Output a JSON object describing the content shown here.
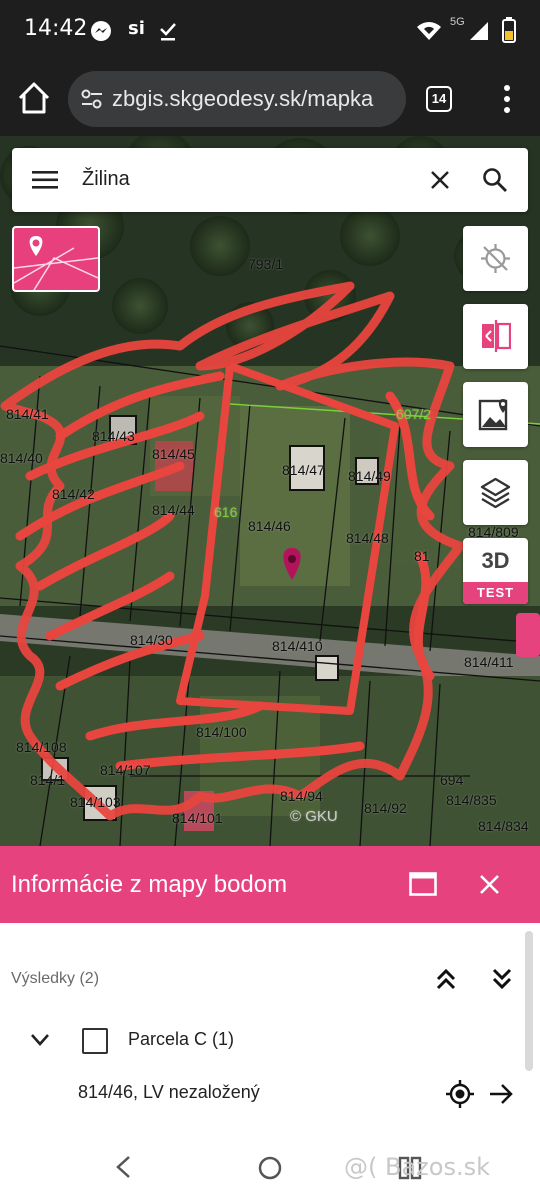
{
  "status_bar": {
    "time": "14:42",
    "icons": [
      "messenger-icon",
      "si-icon",
      "check-icon",
      "wifi-icon",
      "signal-icon",
      "battery-icon"
    ],
    "network": "5G",
    "si": "si"
  },
  "browser": {
    "url": "zbgis.skgeodesy.sk/mapka",
    "tab_count": "14"
  },
  "search": {
    "value": "Žilina"
  },
  "map": {
    "parcels": [
      "793/1",
      "607/2",
      "814/41",
      "814/40",
      "814/43",
      "814/45",
      "814/42",
      "814/44",
      "616",
      "814/46",
      "814/47",
      "814/49",
      "814/48",
      "814/809",
      "814/30",
      "814/410",
      "814/411",
      "814/108",
      "814/100",
      "814/107",
      "814/1",
      "814/103",
      "814/101",
      "814/94",
      "814/92",
      "694",
      "814/835",
      "814/834",
      "81"
    ],
    "copyright": "© GKU",
    "badge_3d": "3D",
    "badge_test": "TEST",
    "accent_color": "#e6427e"
  },
  "info_panel": {
    "title": "Informácie z mapy bodom",
    "results_label": "Výsledky (2)",
    "group_label": "Parcela C (1)",
    "item_label": "814/46, LV nezaložený"
  },
  "nav": {
    "watermark": "@( Bazos.sk"
  }
}
